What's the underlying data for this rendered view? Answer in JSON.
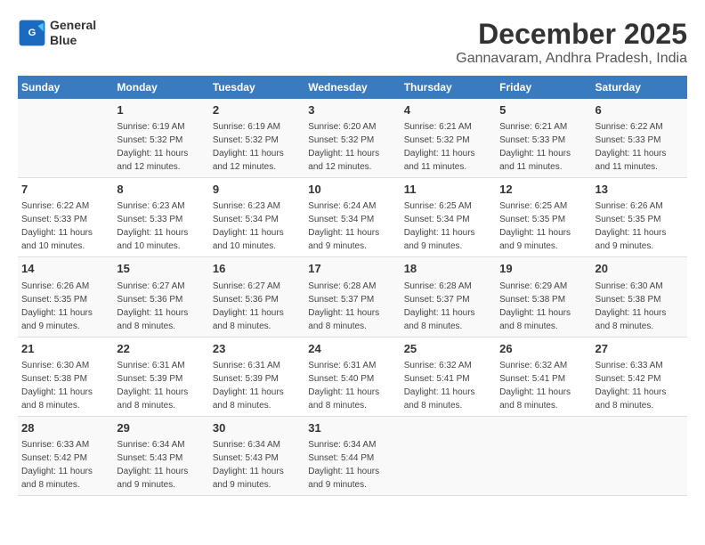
{
  "header": {
    "logo_line1": "General",
    "logo_line2": "Blue",
    "title": "December 2025",
    "subtitle": "Gannavaram, Andhra Pradesh, India"
  },
  "days_of_week": [
    "Sunday",
    "Monday",
    "Tuesday",
    "Wednesday",
    "Thursday",
    "Friday",
    "Saturday"
  ],
  "weeks": [
    [
      {
        "day": "",
        "info": ""
      },
      {
        "day": "1",
        "info": "Sunrise: 6:19 AM\nSunset: 5:32 PM\nDaylight: 11 hours\nand 12 minutes."
      },
      {
        "day": "2",
        "info": "Sunrise: 6:19 AM\nSunset: 5:32 PM\nDaylight: 11 hours\nand 12 minutes."
      },
      {
        "day": "3",
        "info": "Sunrise: 6:20 AM\nSunset: 5:32 PM\nDaylight: 11 hours\nand 12 minutes."
      },
      {
        "day": "4",
        "info": "Sunrise: 6:21 AM\nSunset: 5:32 PM\nDaylight: 11 hours\nand 11 minutes."
      },
      {
        "day": "5",
        "info": "Sunrise: 6:21 AM\nSunset: 5:33 PM\nDaylight: 11 hours\nand 11 minutes."
      },
      {
        "day": "6",
        "info": "Sunrise: 6:22 AM\nSunset: 5:33 PM\nDaylight: 11 hours\nand 11 minutes."
      }
    ],
    [
      {
        "day": "7",
        "info": "Sunrise: 6:22 AM\nSunset: 5:33 PM\nDaylight: 11 hours\nand 10 minutes."
      },
      {
        "day": "8",
        "info": "Sunrise: 6:23 AM\nSunset: 5:33 PM\nDaylight: 11 hours\nand 10 minutes."
      },
      {
        "day": "9",
        "info": "Sunrise: 6:23 AM\nSunset: 5:34 PM\nDaylight: 11 hours\nand 10 minutes."
      },
      {
        "day": "10",
        "info": "Sunrise: 6:24 AM\nSunset: 5:34 PM\nDaylight: 11 hours\nand 9 minutes."
      },
      {
        "day": "11",
        "info": "Sunrise: 6:25 AM\nSunset: 5:34 PM\nDaylight: 11 hours\nand 9 minutes."
      },
      {
        "day": "12",
        "info": "Sunrise: 6:25 AM\nSunset: 5:35 PM\nDaylight: 11 hours\nand 9 minutes."
      },
      {
        "day": "13",
        "info": "Sunrise: 6:26 AM\nSunset: 5:35 PM\nDaylight: 11 hours\nand 9 minutes."
      }
    ],
    [
      {
        "day": "14",
        "info": "Sunrise: 6:26 AM\nSunset: 5:35 PM\nDaylight: 11 hours\nand 9 minutes."
      },
      {
        "day": "15",
        "info": "Sunrise: 6:27 AM\nSunset: 5:36 PM\nDaylight: 11 hours\nand 8 minutes."
      },
      {
        "day": "16",
        "info": "Sunrise: 6:27 AM\nSunset: 5:36 PM\nDaylight: 11 hours\nand 8 minutes."
      },
      {
        "day": "17",
        "info": "Sunrise: 6:28 AM\nSunset: 5:37 PM\nDaylight: 11 hours\nand 8 minutes."
      },
      {
        "day": "18",
        "info": "Sunrise: 6:28 AM\nSunset: 5:37 PM\nDaylight: 11 hours\nand 8 minutes."
      },
      {
        "day": "19",
        "info": "Sunrise: 6:29 AM\nSunset: 5:38 PM\nDaylight: 11 hours\nand 8 minutes."
      },
      {
        "day": "20",
        "info": "Sunrise: 6:30 AM\nSunset: 5:38 PM\nDaylight: 11 hours\nand 8 minutes."
      }
    ],
    [
      {
        "day": "21",
        "info": "Sunrise: 6:30 AM\nSunset: 5:38 PM\nDaylight: 11 hours\nand 8 minutes."
      },
      {
        "day": "22",
        "info": "Sunrise: 6:31 AM\nSunset: 5:39 PM\nDaylight: 11 hours\nand 8 minutes."
      },
      {
        "day": "23",
        "info": "Sunrise: 6:31 AM\nSunset: 5:39 PM\nDaylight: 11 hours\nand 8 minutes."
      },
      {
        "day": "24",
        "info": "Sunrise: 6:31 AM\nSunset: 5:40 PM\nDaylight: 11 hours\nand 8 minutes."
      },
      {
        "day": "25",
        "info": "Sunrise: 6:32 AM\nSunset: 5:41 PM\nDaylight: 11 hours\nand 8 minutes."
      },
      {
        "day": "26",
        "info": "Sunrise: 6:32 AM\nSunset: 5:41 PM\nDaylight: 11 hours\nand 8 minutes."
      },
      {
        "day": "27",
        "info": "Sunrise: 6:33 AM\nSunset: 5:42 PM\nDaylight: 11 hours\nand 8 minutes."
      }
    ],
    [
      {
        "day": "28",
        "info": "Sunrise: 6:33 AM\nSunset: 5:42 PM\nDaylight: 11 hours\nand 8 minutes."
      },
      {
        "day": "29",
        "info": "Sunrise: 6:34 AM\nSunset: 5:43 PM\nDaylight: 11 hours\nand 9 minutes."
      },
      {
        "day": "30",
        "info": "Sunrise: 6:34 AM\nSunset: 5:43 PM\nDaylight: 11 hours\nand 9 minutes."
      },
      {
        "day": "31",
        "info": "Sunrise: 6:34 AM\nSunset: 5:44 PM\nDaylight: 11 hours\nand 9 minutes."
      },
      {
        "day": "",
        "info": ""
      },
      {
        "day": "",
        "info": ""
      },
      {
        "day": "",
        "info": ""
      }
    ]
  ]
}
